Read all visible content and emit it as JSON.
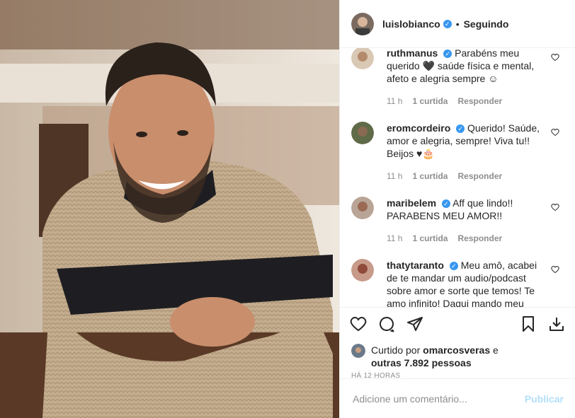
{
  "header": {
    "username": "luislobianco",
    "separator": "•",
    "follow_status": "Seguindo"
  },
  "comments": [
    {
      "username": "ruthmanus",
      "text": "Parabéns meu querido 🖤 saúde física e mental, afeto e alegria sempre ☺",
      "time": "11 h",
      "likes": "1 curtida",
      "reply": "Responder"
    },
    {
      "username": "eromcordeiro",
      "text": "Querido! Saúde, amor e alegria, sempre! Viva tu!! Beijos ♥🎂",
      "time": "11 h",
      "likes": "1 curtida",
      "reply": "Responder"
    },
    {
      "username": "maribelem",
      "text": "Aff que lindo!! PARABENS MEU AMOR!!",
      "time": "11 h",
      "likes": "1 curtida",
      "reply": "Responder"
    },
    {
      "username": "thatytaranto",
      "text": "Meu amô, acabei de te mandar um audio/podcast sobre amor e sorte que temos! Te amo infinito! Daqui mando meu",
      "time": "",
      "likes": "",
      "reply": ""
    }
  ],
  "likes": {
    "prefix": "Curtido por ",
    "user": "omarcosveras",
    "conj": " e",
    "others": "outras 7.892 pessoas"
  },
  "time_ago": "HÁ 12 HORAS",
  "add_comment": {
    "placeholder": "Adicione um comentário...",
    "publish": "Publicar"
  },
  "icons": [
    "heart-icon",
    "comment-icon",
    "share-icon",
    "bookmark-icon",
    "download-icon",
    "verified-icon"
  ],
  "colors": {
    "verified": "#3897f0",
    "publish_disabled": "#b2dffc",
    "meta": "#8e8e8e"
  }
}
